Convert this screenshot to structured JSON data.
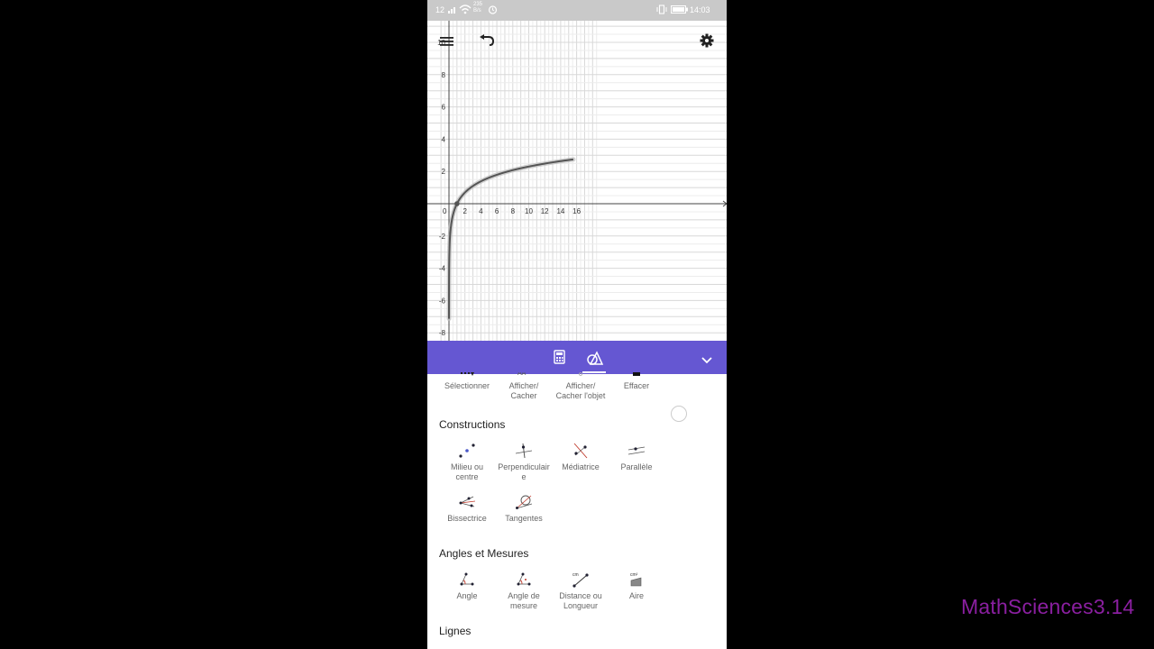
{
  "status_bar": {
    "left_text": "12",
    "speed_value": "235",
    "speed_unit": "B/s",
    "time": "14:03"
  },
  "graph": {
    "x_ticks": [
      "0",
      "2",
      "4",
      "6",
      "8",
      "10",
      "12",
      "14",
      "16"
    ],
    "y_ticks": [
      "10",
      "8",
      "6",
      "4",
      "2",
      "-2",
      "-4",
      "-6",
      "-8"
    ],
    "function": "ln(x)"
  },
  "toolbar": {
    "calculator_icon": "calculator-icon",
    "tools_icon": "geometry-tools-icon",
    "collapse_icon": "chevron-down-icon",
    "accent_color": "#6557d2"
  },
  "tools": {
    "basic": [
      {
        "label": "Sélectionner"
      },
      {
        "label": "Afficher/\nCacher"
      },
      {
        "label": "Afficher/\nCacher l'objet"
      },
      {
        "label": "Effacer"
      }
    ],
    "constructions_title": "Constructions",
    "constructions": [
      {
        "label": "Milieu ou\ncentre"
      },
      {
        "label": "Perpendiculair\ne"
      },
      {
        "label": "Médiatrice"
      },
      {
        "label": "Parallèle"
      },
      {
        "label": "Bissectrice"
      },
      {
        "label": "Tangentes"
      }
    ],
    "measures_title": "Angles et Mesures",
    "measures": [
      {
        "label": "Angle"
      },
      {
        "label": "Angle de\nmesure"
      },
      {
        "label": "Distance ou\nLongueur"
      },
      {
        "label": "Aire"
      }
    ],
    "measures_icon_text": {
      "distance": "cm",
      "area": "cm²"
    },
    "lines_title": "Lignes"
  },
  "watermark": "MathSciences3.14"
}
